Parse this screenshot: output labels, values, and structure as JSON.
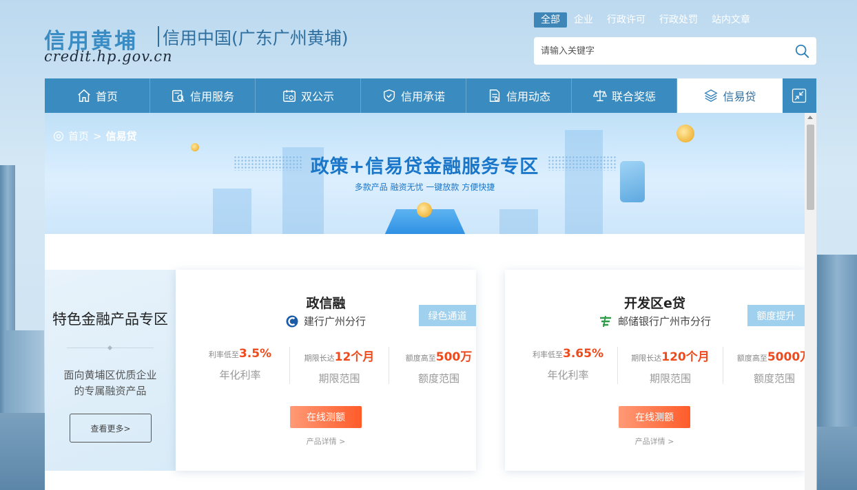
{
  "header": {
    "logo_text": "信用黄埔",
    "site_name": "信用中国(广东广州黄埔)",
    "url_text": "credit.hp.gov.cn"
  },
  "search": {
    "tabs": [
      "全部",
      "企业",
      "行政许可",
      "行政处罚",
      "站内文章"
    ],
    "active_tab": "全部",
    "placeholder": "请输入关键字"
  },
  "nav": {
    "items": [
      {
        "label": "首页",
        "icon": "home-icon"
      },
      {
        "label": "信用服务",
        "icon": "service-icon"
      },
      {
        "label": "双公示",
        "icon": "publicity-icon"
      },
      {
        "label": "信用承诺",
        "icon": "shield-icon"
      },
      {
        "label": "信用动态",
        "icon": "news-icon"
      },
      {
        "label": "联合奖惩",
        "icon": "scale-icon"
      },
      {
        "label": "信易贷",
        "icon": "layers-icon"
      }
    ],
    "active": "信易贷",
    "collapse_icon": "collapse-icon"
  },
  "breadcrumb": {
    "home": "首页",
    "separator": ">",
    "current": "信易贷"
  },
  "banner": {
    "title": "政策+信易贷金融服务专区",
    "subtitle": "多款产品 融资无忧 一键放款 方便快捷"
  },
  "promo": {
    "title": "特色金融产品专区",
    "desc_line1": "面向黄埔区优质企业",
    "desc_line2": "的专属融资产品",
    "button": "查看更多>"
  },
  "products": [
    {
      "name": "政信融",
      "bank": "建行广州分行",
      "bank_icon": "ccb-bank-icon",
      "tag": "绿色通道",
      "stats": [
        {
          "prefix": "利率低至",
          "value": "3.5%",
          "label": "年化利率"
        },
        {
          "prefix": "期限长达",
          "value": "12个月",
          "label": "期限范围"
        },
        {
          "prefix": "额度高至",
          "value": "500万",
          "label": "额度范围"
        }
      ],
      "cta": "在线测额",
      "detail": "产品详情 >"
    },
    {
      "name": "开发区e贷",
      "bank": "邮储银行广州市分行",
      "bank_icon": "psbc-bank-icon",
      "tag": "额度提升",
      "stats": [
        {
          "prefix": "利率低至",
          "value": "3.65%",
          "label": "年化利率"
        },
        {
          "prefix": "期限长达",
          "value": "120个月",
          "label": "期限范围"
        },
        {
          "prefix": "额度高至",
          "value": "5000万",
          "label": "额度范围"
        }
      ],
      "cta": "在线测额",
      "detail": "产品详情 >"
    }
  ],
  "colors": {
    "nav_bg": "#3a8bbf",
    "accent_blue": "#1976c9",
    "highlight_red": "#ee4a1c",
    "tag_bg": "#9fd0ee"
  }
}
